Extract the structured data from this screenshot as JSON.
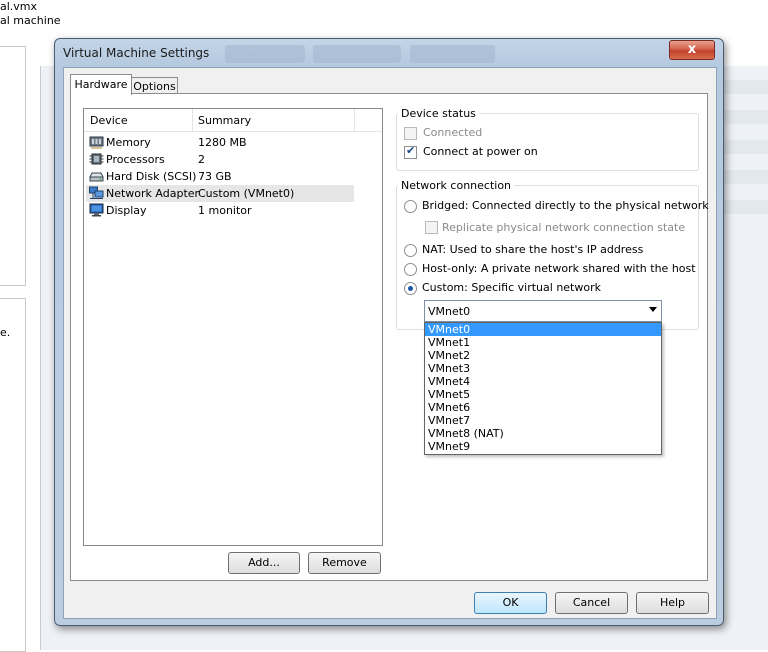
{
  "background": {
    "file_name": "al.vmx",
    "caption": "al machine",
    "side_text": "e.",
    "ghost_tabs": [
      "",
      "",
      ""
    ]
  },
  "dialog": {
    "title": "Virtual Machine Settings",
    "close_label": "x",
    "tabs": [
      {
        "label": "Hardware",
        "active": true
      },
      {
        "label": "Options",
        "active": false
      }
    ],
    "device_list": {
      "columns": [
        "Device",
        "Summary"
      ],
      "rows": [
        {
          "device": "Memory",
          "summary": "1280 MB",
          "icon": "memory-icon",
          "selected": false
        },
        {
          "device": "Processors",
          "summary": "2",
          "icon": "processor-icon",
          "selected": false
        },
        {
          "device": "Hard Disk (SCSI)",
          "summary": "73 GB",
          "icon": "hard-disk-icon",
          "selected": false
        },
        {
          "device": "Network Adapter",
          "summary": "Custom (VMnet0)",
          "icon": "network-adapter-icon",
          "selected": true
        },
        {
          "device": "Display",
          "summary": "1 monitor",
          "icon": "display-icon",
          "selected": false
        }
      ]
    },
    "add_button": "Add...",
    "remove_button": "Remove",
    "device_status": {
      "title": "Device status",
      "connected_label": "Connected",
      "connected_checked": false,
      "connect_power_label": "Connect at power on",
      "connect_power_checked": true
    },
    "network_connection": {
      "title": "Network connection",
      "bridged_label": "Bridged: Connected directly to the physical network",
      "replicate_label": "Replicate physical network connection state",
      "nat_label": "NAT: Used to share the host's IP address",
      "hostonly_label": "Host-only: A private network shared with the host",
      "custom_label": "Custom: Specific virtual network",
      "selected": "custom"
    },
    "vmnet_combo": {
      "value": "VMnet0",
      "options": [
        "VMnet0",
        "VMnet1",
        "VMnet2",
        "VMnet3",
        "VMnet4",
        "VMnet5",
        "VMnet6",
        "VMnet7",
        "VMnet8 (NAT)",
        "VMnet9"
      ],
      "highlighted": "VMnet0"
    },
    "ok_button": "OK",
    "cancel_button": "Cancel",
    "help_button": "Help"
  },
  "colors": {
    "title_bar": "#b5c9df",
    "close_button": "#c2412b",
    "selection": "#3399ff",
    "radio_dot": "#1a55a8"
  }
}
